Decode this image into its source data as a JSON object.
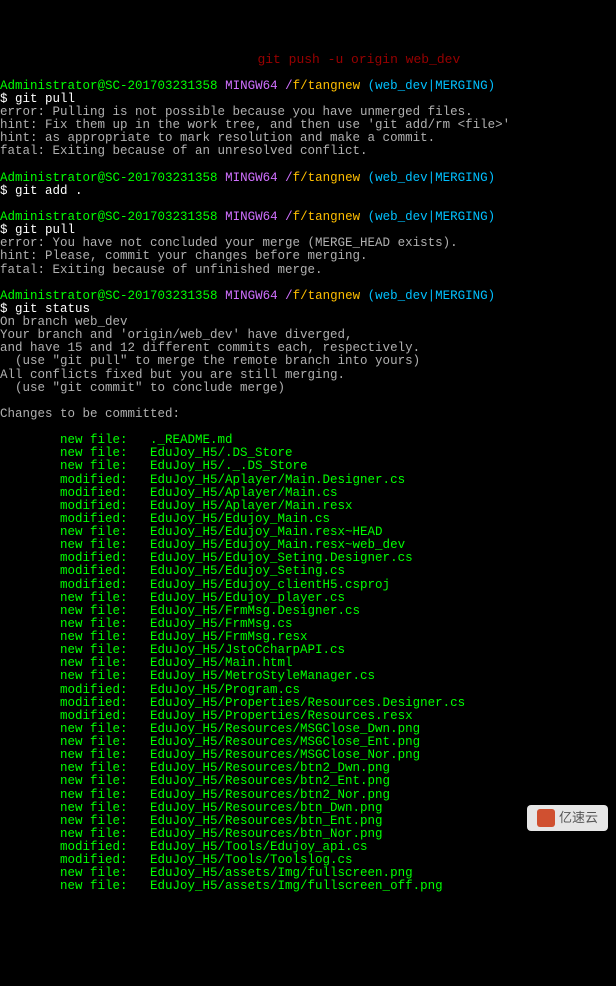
{
  "top_red": "                                 git push -u origin web_dev",
  "prompt": {
    "user": "Administrator@SC-201703231358",
    "mingw": "MINGW64",
    "slash": "/",
    "path": "f/tangnew",
    "branch": "(web_dev|MERGING)"
  },
  "cmd1": "$ git pull",
  "out1": "error: Pulling is not possible because you have unmerged files.\nhint: Fix them up in the work tree, and then use 'git add/rm <file>'\nhint: as appropriate to mark resolution and make a commit.\nfatal: Exiting because of an unresolved conflict.",
  "cmd2": "$ git add .",
  "cmd3": "$ git pull",
  "out3": "error: You have not concluded your merge (MERGE_HEAD exists).\nhint: Please, commit your changes before merging.\nfatal: Exiting because of unfinished merge.",
  "cmd4": "$ git status",
  "out4": "On branch web_dev\nYour branch and 'origin/web_dev' have diverged,\nand have 15 and 12 different commits each, respectively.\n  (use \"git pull\" to merge the remote branch into yours)\nAll conflicts fixed but you are still merging.\n  (use \"git commit\" to conclude merge)\n\nChanges to be committed:",
  "files": [
    "        new file:   ._README.md",
    "        new file:   EduJoy_H5/.DS_Store",
    "        new file:   EduJoy_H5/._.DS_Store",
    "        modified:   EduJoy_H5/Aplayer/Main.Designer.cs",
    "        modified:   EduJoy_H5/Aplayer/Main.cs",
    "        modified:   EduJoy_H5/Aplayer/Main.resx",
    "        modified:   EduJoy_H5/Edujoy_Main.cs",
    "        new file:   EduJoy_H5/Edujoy_Main.resx~HEAD",
    "        new file:   EduJoy_H5/Edujoy_Main.resx~web_dev",
    "        modified:   EduJoy_H5/Edujoy_Seting.Designer.cs",
    "        modified:   EduJoy_H5/Edujoy_Seting.cs",
    "        modified:   EduJoy_H5/Edujoy_clientH5.csproj",
    "        new file:   EduJoy_H5/Edujoy_player.cs",
    "        new file:   EduJoy_H5/FrmMsg.Designer.cs",
    "        new file:   EduJoy_H5/FrmMsg.cs",
    "        new file:   EduJoy_H5/FrmMsg.resx",
    "        new file:   EduJoy_H5/JstoCcharpAPI.cs",
    "        new file:   EduJoy_H5/Main.html",
    "        new file:   EduJoy_H5/MetroStyleManager.cs",
    "        modified:   EduJoy_H5/Program.cs",
    "        modified:   EduJoy_H5/Properties/Resources.Designer.cs",
    "        modified:   EduJoy_H5/Properties/Resources.resx",
    "        new file:   EduJoy_H5/Resources/MSGClose_Dwn.png",
    "        new file:   EduJoy_H5/Resources/MSGClose_Ent.png",
    "        new file:   EduJoy_H5/Resources/MSGClose_Nor.png",
    "        new file:   EduJoy_H5/Resources/btn2_Dwn.png",
    "        new file:   EduJoy_H5/Resources/btn2_Ent.png",
    "        new file:   EduJoy_H5/Resources/btn2_Nor.png",
    "        new file:   EduJoy_H5/Resources/btn_Dwn.png",
    "        new file:   EduJoy_H5/Resources/btn_Ent.png",
    "        new file:   EduJoy_H5/Resources/btn_Nor.png",
    "        modified:   EduJoy_H5/Tools/Edujoy_api.cs",
    "        modified:   EduJoy_H5/Tools/Toolslog.cs",
    "        new file:   EduJoy_H5/assets/Img/fullscreen.png",
    "        new file:   EduJoy_H5/assets/Img/fullscreen_off.png"
  ],
  "watermark": "亿速云"
}
